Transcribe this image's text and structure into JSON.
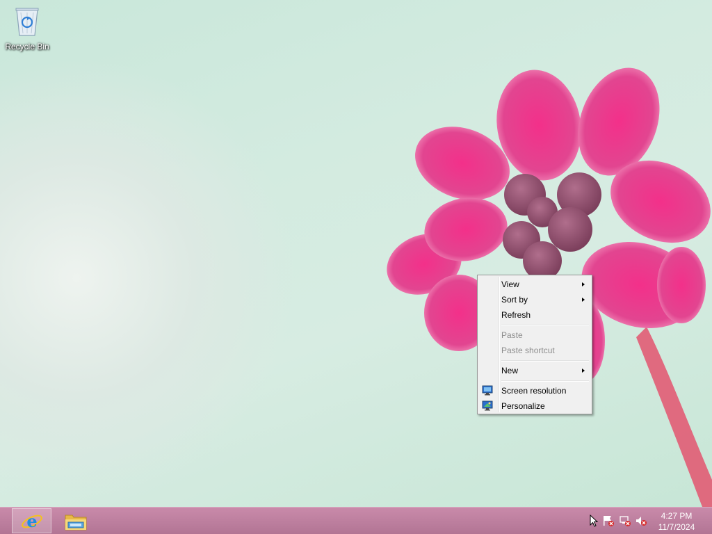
{
  "desktop": {
    "icons": [
      {
        "label": "Recycle Bin",
        "icon": "recycle-bin-icon"
      }
    ]
  },
  "context_menu": {
    "items": [
      {
        "label": "View",
        "submenu": true,
        "enabled": true
      },
      {
        "label": "Sort by",
        "submenu": true,
        "enabled": true
      },
      {
        "label": "Refresh",
        "submenu": false,
        "enabled": true
      },
      {
        "label": "Paste",
        "submenu": false,
        "enabled": false
      },
      {
        "label": "Paste shortcut",
        "submenu": false,
        "enabled": false
      },
      {
        "label": "New",
        "submenu": true,
        "enabled": true
      },
      {
        "label": "Screen resolution",
        "submenu": false,
        "enabled": true,
        "icon": "monitor-icon"
      },
      {
        "label": "Personalize",
        "submenu": false,
        "enabled": true,
        "icon": "personalize-icon"
      }
    ]
  },
  "taskbar": {
    "pinned": [
      {
        "name": "Internet Explorer",
        "icon": "internet-explorer-icon",
        "active": true
      },
      {
        "name": "File Explorer",
        "icon": "file-explorer-icon",
        "active": false
      }
    ],
    "tray": {
      "icons": [
        "cursor-icon",
        "action-center-flag-icon",
        "network-disconnected-icon",
        "volume-muted-icon"
      ],
      "time": "4:27 PM",
      "date": "11/7/2024"
    }
  },
  "colors": {
    "taskbar": "#b97b9b",
    "desktop_bg": "#cfe9dd",
    "flower": "#e8448e",
    "menu_bg": "#f0f0f0"
  }
}
